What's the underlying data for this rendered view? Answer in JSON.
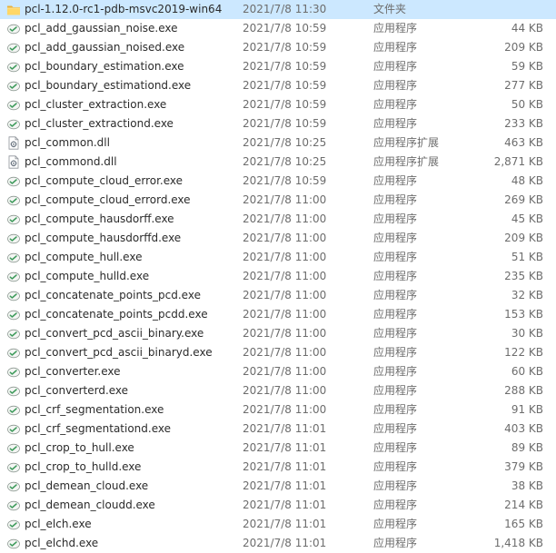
{
  "file_list": {
    "rows": [
      {
        "name": "pcl-1.12.0-rc1-pdb-msvc2019-win64",
        "date": "2021/7/8 11:30",
        "type": "文件夹",
        "size": "",
        "icon": "folder-icon",
        "selected": true
      },
      {
        "name": "pcl_add_gaussian_noise.exe",
        "date": "2021/7/8 10:59",
        "type": "应用程序",
        "size": "44 KB",
        "icon": "exe-icon"
      },
      {
        "name": "pcl_add_gaussian_noised.exe",
        "date": "2021/7/8 10:59",
        "type": "应用程序",
        "size": "209 KB",
        "icon": "exe-icon"
      },
      {
        "name": "pcl_boundary_estimation.exe",
        "date": "2021/7/8 10:59",
        "type": "应用程序",
        "size": "59 KB",
        "icon": "exe-icon"
      },
      {
        "name": "pcl_boundary_estimationd.exe",
        "date": "2021/7/8 10:59",
        "type": "应用程序",
        "size": "277 KB",
        "icon": "exe-icon"
      },
      {
        "name": "pcl_cluster_extraction.exe",
        "date": "2021/7/8 10:59",
        "type": "应用程序",
        "size": "50 KB",
        "icon": "exe-icon"
      },
      {
        "name": "pcl_cluster_extractiond.exe",
        "date": "2021/7/8 10:59",
        "type": "应用程序",
        "size": "233 KB",
        "icon": "exe-icon"
      },
      {
        "name": "pcl_common.dll",
        "date": "2021/7/8 10:25",
        "type": "应用程序扩展",
        "size": "463 KB",
        "icon": "dll-icon"
      },
      {
        "name": "pcl_commond.dll",
        "date": "2021/7/8 10:25",
        "type": "应用程序扩展",
        "size": "2,871 KB",
        "icon": "dll-icon"
      },
      {
        "name": "pcl_compute_cloud_error.exe",
        "date": "2021/7/8 10:59",
        "type": "应用程序",
        "size": "48 KB",
        "icon": "exe-icon"
      },
      {
        "name": "pcl_compute_cloud_errord.exe",
        "date": "2021/7/8 11:00",
        "type": "应用程序",
        "size": "269 KB",
        "icon": "exe-icon"
      },
      {
        "name": "pcl_compute_hausdorff.exe",
        "date": "2021/7/8 11:00",
        "type": "应用程序",
        "size": "45 KB",
        "icon": "exe-icon"
      },
      {
        "name": "pcl_compute_hausdorffd.exe",
        "date": "2021/7/8 11:00",
        "type": "应用程序",
        "size": "209 KB",
        "icon": "exe-icon"
      },
      {
        "name": "pcl_compute_hull.exe",
        "date": "2021/7/8 11:00",
        "type": "应用程序",
        "size": "51 KB",
        "icon": "exe-icon"
      },
      {
        "name": "pcl_compute_hulld.exe",
        "date": "2021/7/8 11:00",
        "type": "应用程序",
        "size": "235 KB",
        "icon": "exe-icon"
      },
      {
        "name": "pcl_concatenate_points_pcd.exe",
        "date": "2021/7/8 11:00",
        "type": "应用程序",
        "size": "32 KB",
        "icon": "exe-icon"
      },
      {
        "name": "pcl_concatenate_points_pcdd.exe",
        "date": "2021/7/8 11:00",
        "type": "应用程序",
        "size": "153 KB",
        "icon": "exe-icon"
      },
      {
        "name": "pcl_convert_pcd_ascii_binary.exe",
        "date": "2021/7/8 11:00",
        "type": "应用程序",
        "size": "30 KB",
        "icon": "exe-icon"
      },
      {
        "name": "pcl_convert_pcd_ascii_binaryd.exe",
        "date": "2021/7/8 11:00",
        "type": "应用程序",
        "size": "122 KB",
        "icon": "exe-icon"
      },
      {
        "name": "pcl_converter.exe",
        "date": "2021/7/8 11:00",
        "type": "应用程序",
        "size": "60 KB",
        "icon": "exe-icon"
      },
      {
        "name": "pcl_converterd.exe",
        "date": "2021/7/8 11:00",
        "type": "应用程序",
        "size": "288 KB",
        "icon": "exe-icon"
      },
      {
        "name": "pcl_crf_segmentation.exe",
        "date": "2021/7/8 11:00",
        "type": "应用程序",
        "size": "91 KB",
        "icon": "exe-icon"
      },
      {
        "name": "pcl_crf_segmentationd.exe",
        "date": "2021/7/8 11:01",
        "type": "应用程序",
        "size": "403 KB",
        "icon": "exe-icon"
      },
      {
        "name": "pcl_crop_to_hull.exe",
        "date": "2021/7/8 11:01",
        "type": "应用程序",
        "size": "89 KB",
        "icon": "exe-icon"
      },
      {
        "name": "pcl_crop_to_hulld.exe",
        "date": "2021/7/8 11:01",
        "type": "应用程序",
        "size": "379 KB",
        "icon": "exe-icon"
      },
      {
        "name": "pcl_demean_cloud.exe",
        "date": "2021/7/8 11:01",
        "type": "应用程序",
        "size": "38 KB",
        "icon": "exe-icon"
      },
      {
        "name": "pcl_demean_cloudd.exe",
        "date": "2021/7/8 11:01",
        "type": "应用程序",
        "size": "214 KB",
        "icon": "exe-icon"
      },
      {
        "name": "pcl_elch.exe",
        "date": "2021/7/8 11:01",
        "type": "应用程序",
        "size": "165 KB",
        "icon": "exe-icon"
      },
      {
        "name": "pcl_elchd.exe",
        "date": "2021/7/8 11:01",
        "type": "应用程序",
        "size": "1,418 KB",
        "icon": "exe-icon"
      }
    ]
  },
  "colors": {
    "selected_bg": "#cce8ff",
    "text": "#2b2b2b",
    "secondary_text": "#6d6d6d",
    "folder": "#ffd766"
  }
}
